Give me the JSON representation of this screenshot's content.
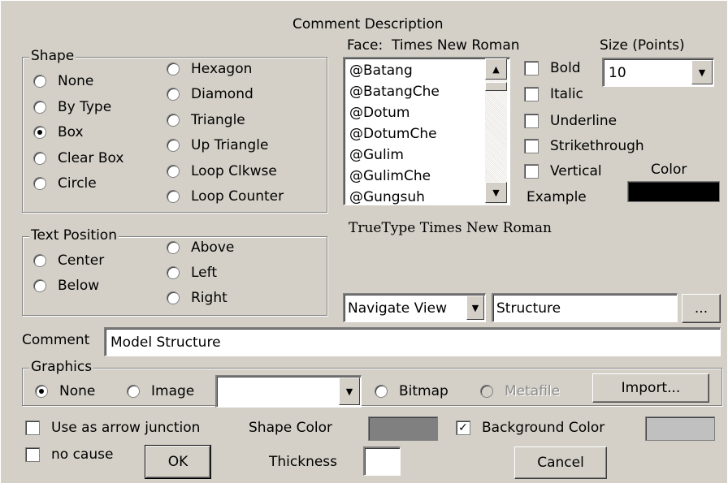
{
  "title": "Comment Description",
  "shape": {
    "legend": "Shape",
    "options": [
      "None",
      "By Type",
      "Box",
      "Clear Box",
      "Circle",
      "Hexagon",
      "Diamond",
      "Triangle",
      "Up Triangle",
      "Loop Clkwse",
      "Loop Counter"
    ],
    "selected": "Box"
  },
  "text_position": {
    "legend": "Text Position",
    "options": [
      "Center",
      "Below",
      "Above",
      "Left",
      "Right"
    ]
  },
  "font": {
    "face_label": "Face:",
    "face_value": "Times New Roman",
    "size_label": "Size (Points)",
    "size_value": "10",
    "list": [
      "@Batang",
      "@BatangChe",
      "@Dotum",
      "@DotumChe",
      "@Gulim",
      "@GulimChe",
      "@Gungsuh"
    ],
    "styles": [
      "Bold",
      "Italic",
      "Underline",
      "Strikethrough",
      "Vertical"
    ],
    "color_label": "Color",
    "example_label": "Example",
    "color_value": "#000000",
    "sample_text": "TrueType Times New Roman"
  },
  "navigate": {
    "view_value": "Navigate View",
    "target_value": "Structure",
    "browse_label": "..."
  },
  "comment": {
    "label": "Comment",
    "value": "Model Structure"
  },
  "graphics": {
    "legend": "Graphics",
    "none_label": "None",
    "image_label": "Image",
    "bitmap_label": "Bitmap",
    "metafile_label": "Metafile",
    "import_label": "Import...",
    "selected": "None"
  },
  "bottom": {
    "arrow_junction_label": "Use as arrow junction",
    "no_cause_label": "no cause",
    "shape_color_label": "Shape Color",
    "shape_color": "#808080",
    "background_color_label": "Background Color",
    "background_color": "#c0c0c0",
    "background_checked": true,
    "thickness_label": "Thickness",
    "ok_label": "OK",
    "cancel_label": "Cancel"
  }
}
